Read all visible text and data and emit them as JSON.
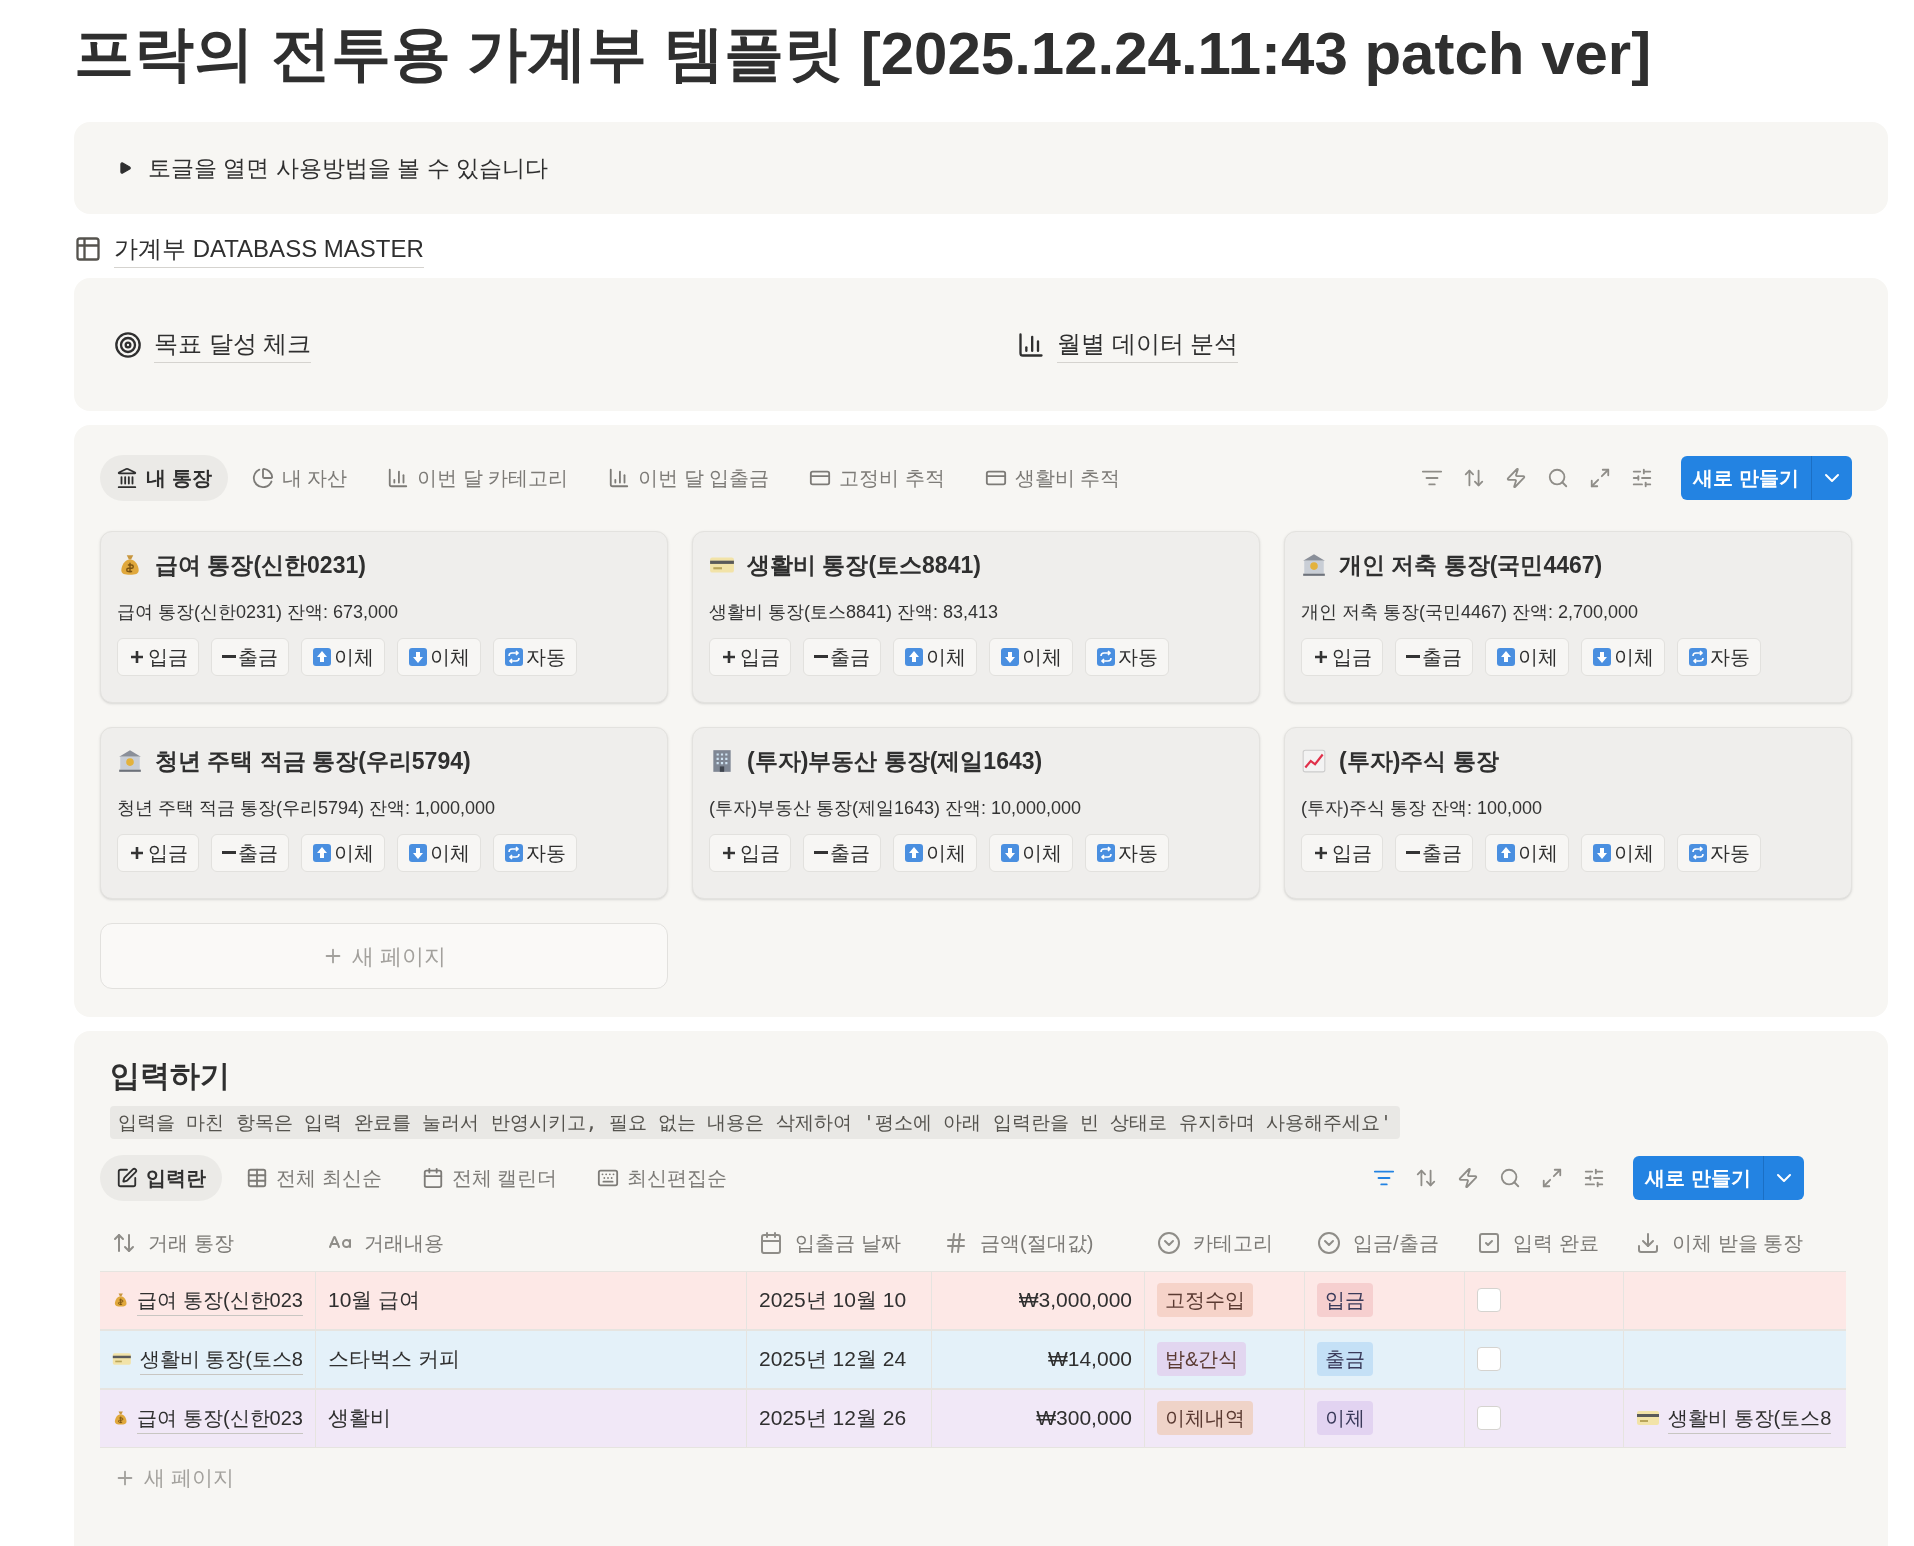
{
  "title": "프락의 전투용 가계부 템플릿 [2025.12.24.11:43 patch ver]",
  "toggle": {
    "label": "토글을 열면 사용방법을 볼 수 있습니다",
    "expanded": false
  },
  "database_link": "가계부 DATABASS MASTER",
  "links": [
    {
      "kind": "target",
      "label": "목표 달성 체크"
    },
    {
      "kind": "chart",
      "label": "월별 데이터 분석"
    }
  ],
  "board": {
    "tabs": [
      {
        "kind": "bank",
        "label": "내 통장",
        "selected": true
      },
      {
        "kind": "pie",
        "label": "내 자산",
        "selected": false
      },
      {
        "kind": "chart",
        "label": "이번 달 카테고리",
        "selected": false
      },
      {
        "kind": "chart",
        "label": "이번 달 입출금",
        "selected": false
      },
      {
        "kind": "card",
        "label": "고정비 추적",
        "selected": false
      },
      {
        "kind": "card",
        "label": "생활비 추적",
        "selected": false
      }
    ],
    "new_button": "새로 만들기",
    "cards": [
      {
        "kind": "money",
        "title": "급여 통장(신한0231)",
        "balance": "급여 통장(신한0231) 잔액: 673,000",
        "buttons": [
          {
            "kind": "plus",
            "label": "입금"
          },
          {
            "kind": "minus",
            "label": "출금"
          },
          {
            "kind": "up",
            "label": "이체"
          },
          {
            "kind": "down",
            "label": "이체"
          },
          {
            "kind": "repeat",
            "label": "자동"
          }
        ]
      },
      {
        "kind": "card",
        "title": "생활비 통장(토스8841)",
        "balance": "생활비 통장(토스8841) 잔액: 83,413",
        "buttons": [
          {
            "kind": "plus",
            "label": "입금"
          },
          {
            "kind": "minus",
            "label": "출금"
          },
          {
            "kind": "up",
            "label": "이체"
          },
          {
            "kind": "down",
            "label": "이체"
          },
          {
            "kind": "repeat",
            "label": "자동"
          }
        ]
      },
      {
        "kind": "bank",
        "title": "개인 저축 통장(국민4467)",
        "balance": "개인 저축 통장(국민4467) 잔액: 2,700,000",
        "buttons": [
          {
            "kind": "plus",
            "label": "입금"
          },
          {
            "kind": "minus",
            "label": "출금"
          },
          {
            "kind": "up",
            "label": "이체"
          },
          {
            "kind": "down",
            "label": "이체"
          },
          {
            "kind": "repeat",
            "label": "자동"
          }
        ]
      },
      {
        "kind": "bank",
        "title": "청년 주택 적금 통장(우리5794)",
        "balance": "청년 주택 적금 통장(우리5794) 잔액: 1,000,000",
        "buttons": [
          {
            "kind": "plus",
            "label": "입금"
          },
          {
            "kind": "minus",
            "label": "출금"
          },
          {
            "kind": "up",
            "label": "이체"
          },
          {
            "kind": "down",
            "label": "이체"
          },
          {
            "kind": "repeat",
            "label": "자동"
          }
        ]
      },
      {
        "kind": "building",
        "title": "(투자)부동산 통장(제일1643)",
        "balance": "(투자)부동산 통장(제일1643) 잔액: 10,000,000",
        "buttons": [
          {
            "kind": "plus",
            "label": "입금"
          },
          {
            "kind": "minus",
            "label": "출금"
          },
          {
            "kind": "up",
            "label": "이체"
          },
          {
            "kind": "down",
            "label": "이체"
          },
          {
            "kind": "repeat",
            "label": "자동"
          }
        ]
      },
      {
        "kind": "trend",
        "title": "(투자)주식 통장",
        "balance": "(투자)주식 통장 잔액: 100,000",
        "buttons": [
          {
            "kind": "plus",
            "label": "입금"
          },
          {
            "kind": "minus",
            "label": "출금"
          },
          {
            "kind": "up",
            "label": "이체"
          },
          {
            "kind": "down",
            "label": "이체"
          },
          {
            "kind": "repeat",
            "label": "자동"
          }
        ]
      }
    ],
    "new_page": "새 페이지"
  },
  "input": {
    "heading": "입력하기",
    "note": "입력을 마친 항목은 입력 완료를 눌러서 반영시키고, 필요 없는 내용은 삭제하여 '평소에 아래 입력란을 빈 상태로 유지하며 사용해주세요'",
    "tabs": [
      {
        "kind": "edit",
        "label": "입력란",
        "selected": true
      },
      {
        "kind": "table",
        "label": "전체 최신순",
        "selected": false
      },
      {
        "kind": "calendar",
        "label": "전체 캘린더",
        "selected": false
      },
      {
        "kind": "keyboard",
        "label": "최신편집순",
        "selected": false
      }
    ],
    "new_button": "새로 만들기",
    "columns": [
      {
        "kind": "sort",
        "label": "거래 통장"
      },
      {
        "kind": "text",
        "label": "거래내용"
      },
      {
        "kind": "date",
        "label": "입출금 날짜"
      },
      {
        "kind": "number",
        "label": "금액(절대값)"
      },
      {
        "kind": "select",
        "label": "카테고리"
      },
      {
        "kind": "select",
        "label": "입금/출금"
      },
      {
        "kind": "check",
        "label": "입력 완료"
      },
      {
        "kind": "download",
        "label": "이체 받을 통장"
      }
    ],
    "rows": [
      {
        "color": "#fde8e6",
        "account": {
          "kind": "money",
          "label": "급여 통장(신한023"
        },
        "content": "10월 급여",
        "date": "2025년 10월 10",
        "amount": "₩3,000,000",
        "category": {
          "label": "고정수입",
          "color": "#f6d3c9"
        },
        "direction": {
          "label": "입금",
          "color": "#f6cfcf"
        },
        "done": false
      },
      {
        "color": "#e4f1f9",
        "account": {
          "kind": "card",
          "label": "생활비 통장(토스8"
        },
        "content": "스타벅스 커피",
        "date": "2025년 12월 24",
        "amount": "₩14,000",
        "category": {
          "label": "밥&간식",
          "color": "#e2d6f0"
        },
        "direction": {
          "label": "출금",
          "color": "#c4e0f6"
        },
        "done": false
      },
      {
        "color": "#f1e8f7",
        "account": {
          "kind": "money",
          "label": "급여 통장(신한023"
        },
        "content": "생활비",
        "date": "2025년 12월 26",
        "amount": "₩300,000",
        "category": {
          "label": "이체내역",
          "color": "#efd3c8"
        },
        "direction": {
          "label": "이체",
          "color": "#e2d3f1"
        },
        "done": false,
        "transfer": {
          "kind": "card",
          "label": "생활비 통장(토스8"
        }
      }
    ],
    "new_page": "새 페이지"
  }
}
